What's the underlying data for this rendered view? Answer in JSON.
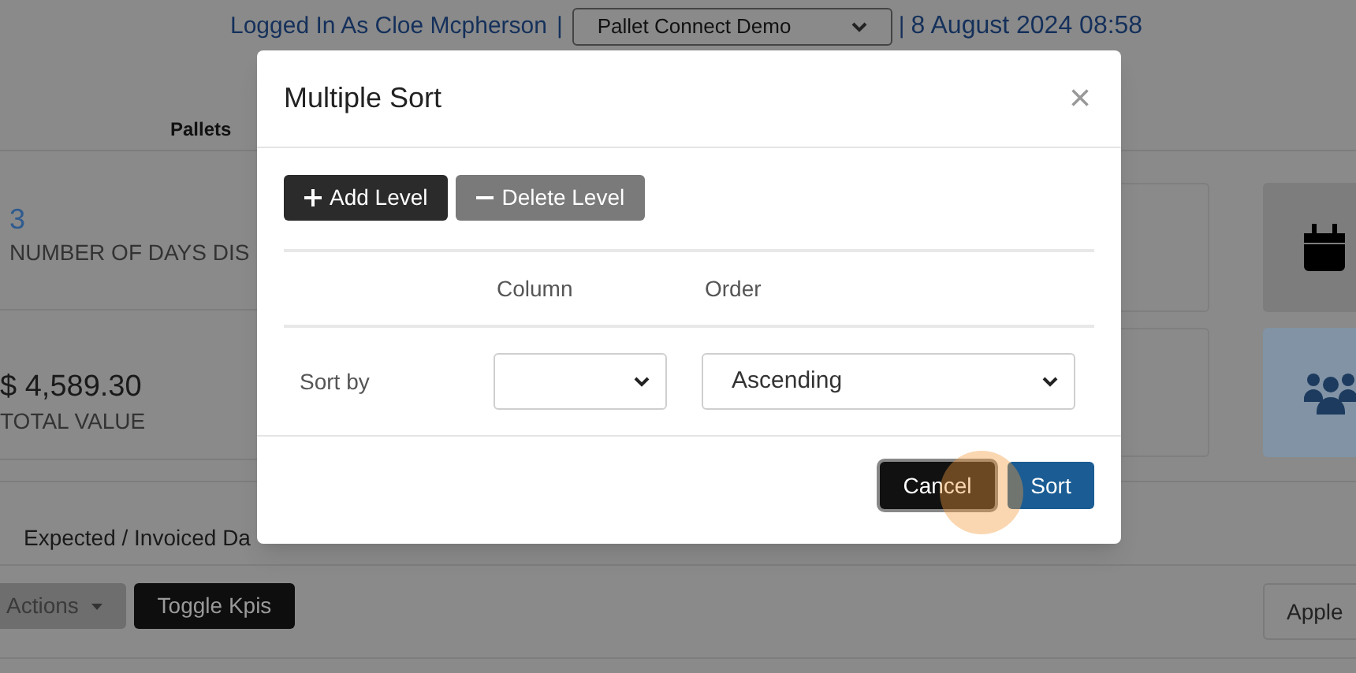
{
  "header": {
    "user_link": "Logged In As Cloe Mcpherson",
    "separator_1": "|",
    "account_select": {
      "value": "Pallet Connect Demo"
    },
    "separator_2": "|",
    "datetime": "8 August 2024 08:58"
  },
  "section_label": "Pallets",
  "kpis": [
    {
      "value": "3",
      "label": "NUMBER OF DAYS DIS"
    },
    {
      "value": "$ 4,589.30",
      "label": "TOTAL VALUE"
    }
  ],
  "tab_label": "Expected / Invoiced Da",
  "toolbar": {
    "actions": "Actions",
    "toggle": "Toggle Kpis",
    "right_button": "Apple"
  },
  "modal": {
    "title": "Multiple Sort",
    "close": "×",
    "buttons": [
      {
        "kind": "add",
        "label": "Add Level"
      },
      {
        "kind": "delete",
        "label": "Delete Level"
      }
    ],
    "columns": [
      "Column",
      "Order"
    ],
    "rows": [
      {
        "label": "Sort by",
        "column": {},
        "order": {
          "value": "Ascending"
        }
      }
    ],
    "footer": [
      {
        "kind": "cancel",
        "label": "Cancel"
      },
      {
        "kind": "sort",
        "label": "Sort"
      }
    ]
  }
}
